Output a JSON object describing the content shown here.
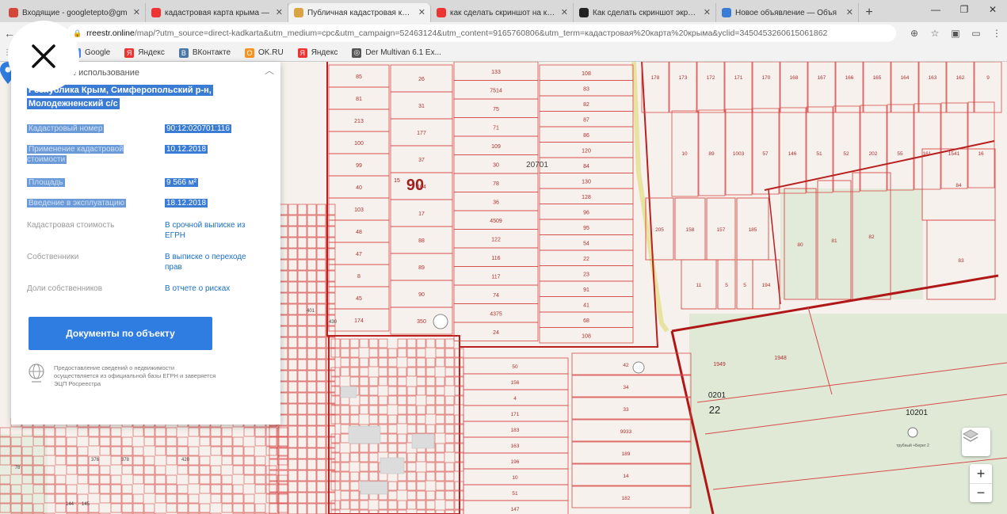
{
  "browser": {
    "tabs": [
      {
        "title": "Входящие - googletepto@gm",
        "color": "#d44638",
        "active": false
      },
      {
        "title": "кадастровая карта крыма —",
        "color": "#e33",
        "active": false
      },
      {
        "title": "Публичная кадастровая карта",
        "color": "#d9a441",
        "active": true
      },
      {
        "title": "как сделать скриншот на ком",
        "color": "#e33",
        "active": false
      },
      {
        "title": "Как сделать скриншот экрана",
        "color": "#222",
        "active": false
      },
      {
        "title": "Новое объявление — Объя",
        "color": "#3a7bd5",
        "active": false
      }
    ],
    "url_host": "rreestr.online",
    "url_rest": "/map/?utm_source=direct-kadkarta&utm_medium=cpc&utm_campaign=52463124&utm_content=9165760806&utm_term=кадастровая%20карта%20крыма&yclid=3450453260615061862",
    "bookmarks": [
      {
        "label": "Google",
        "color": "#4285f4",
        "glyph": "G"
      },
      {
        "label": "Яндекс",
        "color": "#e33",
        "glyph": "Я"
      },
      {
        "label": "ВКонтакте",
        "color": "#4a76a8",
        "glyph": "В"
      },
      {
        "label": "OK.RU",
        "color": "#f7931e",
        "glyph": "O"
      },
      {
        "label": "Яндекс",
        "color": "#e33",
        "glyph": "Я"
      },
      {
        "label": "Der Multivan 6.1 Ex...",
        "color": "#555",
        "glyph": "◎"
      }
    ]
  },
  "panel": {
    "usage_label": "...йственное использование",
    "address": "Республика Крым, Симферопольский р-н, Молодежненский с/с",
    "rows": [
      {
        "key": "Кадастровый номер",
        "value": "90:12:020701:116",
        "selected": true
      },
      {
        "key": "Применение кадастровой стоимости",
        "value": "10.12.2018",
        "selected": true
      },
      {
        "key": "Площадь",
        "value": "9 566 м²",
        "selected": true
      },
      {
        "key": "Введение в эксплуатацию",
        "value": "18.12.2018",
        "selected": true
      },
      {
        "key": "Кадастровая стоимость",
        "value": "В срочной выписке из ЕГРН",
        "selected": false
      },
      {
        "key": "Собственники",
        "value": "В выписке о переходе прав",
        "selected": false
      },
      {
        "key": "Доли собственников",
        "value": "В отчете о рисках",
        "selected": false
      }
    ],
    "docs_button": "Документы по объекту",
    "disclaimer": "Предоставление сведений о недвижимости осуществляется из официальной базы ЕГРН и заверяется ЭЦП Росреестра"
  },
  "map": {
    "labels": {
      "quarter": "20701",
      "big_90": "90",
      "label_15": "15",
      "zone_0201": "0201",
      "zone_22": "22",
      "zone_10201": "10201",
      "zone_1949": "1949",
      "zone_1948": "1948",
      "poi": "трубный +Берег 2"
    },
    "col1": [
      "85",
      "81",
      "213",
      "100",
      "99",
      "40",
      "103",
      "48",
      "47",
      "8",
      "45",
      "174"
    ],
    "col2": [
      "26",
      "31",
      "177",
      "37",
      "104",
      "17",
      "88",
      "89",
      "90",
      "350"
    ],
    "col3": [
      "133",
      "7514",
      "75",
      "71",
      "109",
      "30",
      "78",
      "36",
      "4509",
      "122",
      "116",
      "117",
      "74",
      "4375",
      "24"
    ],
    "col4": [
      "108",
      "83",
      "82",
      "87",
      "86",
      "120",
      "84",
      "130",
      "128",
      "96",
      "95",
      "54",
      "22",
      "23",
      "91",
      "41",
      "68",
      "108"
    ],
    "right_top": [
      "178",
      "173",
      "172",
      "171",
      "170",
      "168",
      "167",
      "166",
      "165",
      "164",
      "163",
      "162",
      "9"
    ],
    "right_mid": [
      "10",
      "89",
      "1003",
      "57",
      "146",
      "51",
      "52",
      "202",
      "55",
      "161",
      "1541",
      "16"
    ],
    "right_lower": [
      "205",
      "158",
      "157",
      "185",
      "11",
      "5",
      "5",
      "194",
      "80",
      "81",
      "82",
      "83",
      "84"
    ],
    "bottom_mid": [
      "50",
      "156",
      "4",
      "171",
      "183",
      "163",
      "196",
      "10",
      "51",
      "147"
    ],
    "bottom_right": [
      "42",
      "34",
      "33",
      "9933",
      "189",
      "14",
      "182"
    ],
    "left_misc": [
      "401",
      "430",
      "376",
      "378",
      "420",
      "78",
      "144",
      "145"
    ]
  },
  "controls": {
    "zoom_in": "+",
    "zoom_out": "−"
  }
}
